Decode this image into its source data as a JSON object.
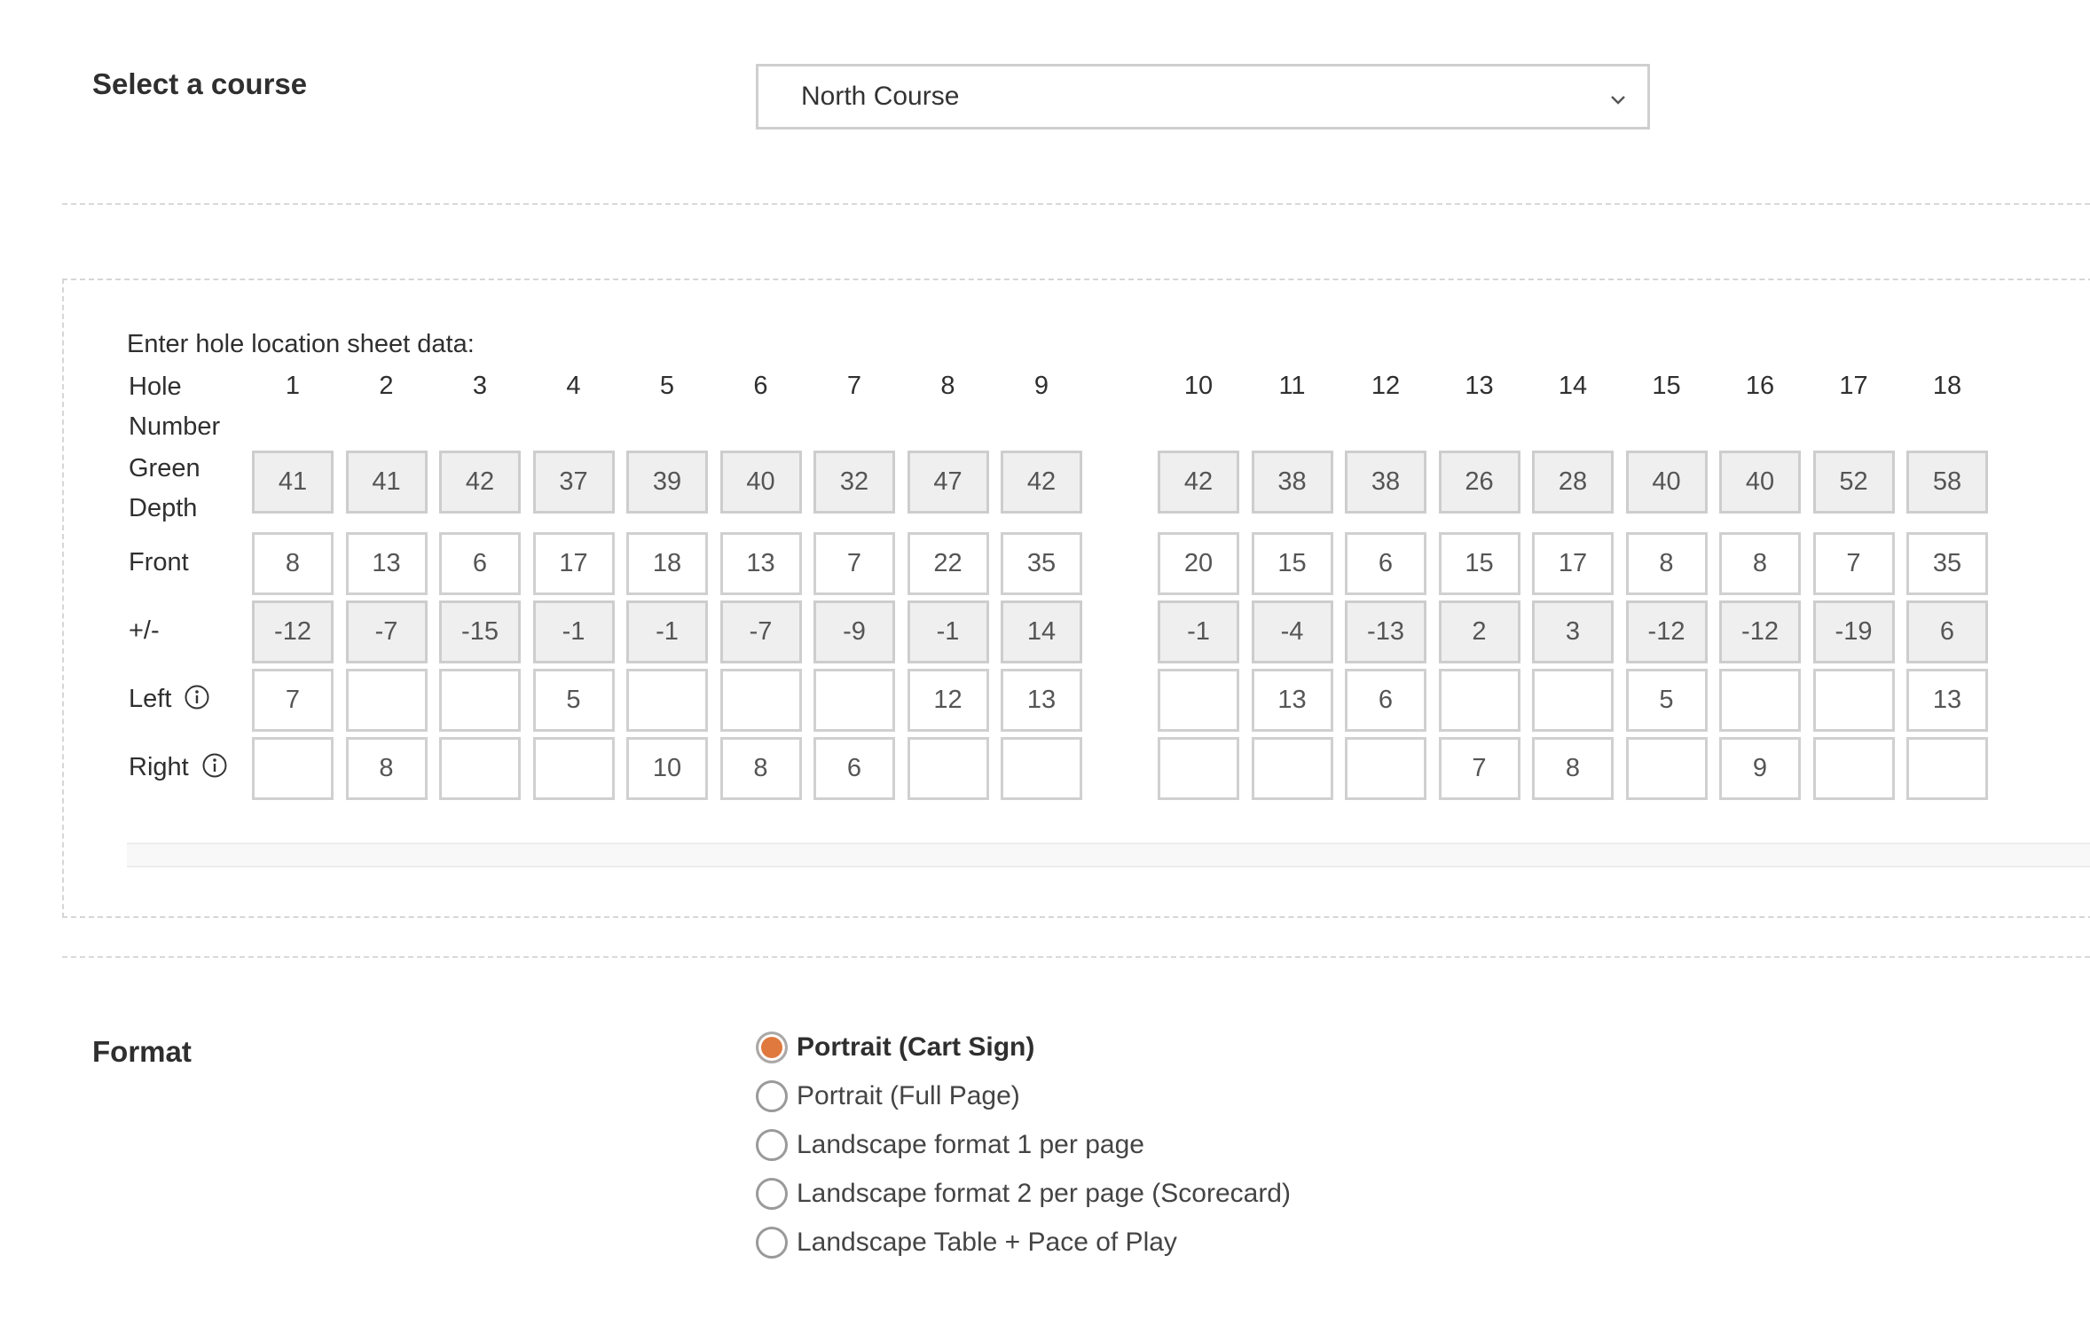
{
  "course": {
    "label": "Select a course",
    "selected": "North Course"
  },
  "sheet": {
    "title": "Enter hole location sheet data:",
    "row_labels": {
      "hole_number": [
        "Hole",
        "Number"
      ],
      "green_depth": [
        "Green",
        "Depth"
      ],
      "front": "Front",
      "plus_minus": "+/-",
      "left": "Left",
      "right": "Right"
    },
    "holes": [
      "1",
      "2",
      "3",
      "4",
      "5",
      "6",
      "7",
      "8",
      "9",
      "10",
      "11",
      "12",
      "13",
      "14",
      "15",
      "16",
      "17",
      "18"
    ],
    "green_depth": [
      "41",
      "41",
      "42",
      "37",
      "39",
      "40",
      "32",
      "47",
      "42",
      "42",
      "38",
      "38",
      "26",
      "28",
      "40",
      "40",
      "52",
      "58"
    ],
    "front": [
      "8",
      "13",
      "6",
      "17",
      "18",
      "13",
      "7",
      "22",
      "35",
      "20",
      "15",
      "6",
      "15",
      "17",
      "8",
      "8",
      "7",
      "35"
    ],
    "plus_minus": [
      "-12",
      "-7",
      "-15",
      "-1",
      "-1",
      "-7",
      "-9",
      "-1",
      "14",
      "-1",
      "-4",
      "-13",
      "2",
      "3",
      "-12",
      "-12",
      "-19",
      "6"
    ],
    "left": [
      "7",
      "",
      "",
      "5",
      "",
      "",
      "",
      "12",
      "13",
      "",
      "13",
      "6",
      "",
      "",
      "5",
      "",
      "",
      "13"
    ],
    "right": [
      "",
      "8",
      "",
      "",
      "10",
      "8",
      "6",
      "",
      "",
      "",
      "",
      "",
      "7",
      "8",
      "",
      "9",
      "",
      ""
    ]
  },
  "format": {
    "label": "Format",
    "options": [
      {
        "label": "Portrait (Cart Sign)",
        "selected": true
      },
      {
        "label": "Portrait (Full Page)",
        "selected": false
      },
      {
        "label": "Landscape format 1 per page",
        "selected": false
      },
      {
        "label": "Landscape format 2 per page (Scorecard)",
        "selected": false
      },
      {
        "label": "Landscape Table + Pace of Play",
        "selected": false
      }
    ]
  },
  "icons": {
    "select_chevron": "chevron-down-icon",
    "info": "info-icon"
  },
  "colors": {
    "accent": "#e0793e",
    "readonly_cell": "#efefef",
    "border": "#d0d0d0"
  }
}
